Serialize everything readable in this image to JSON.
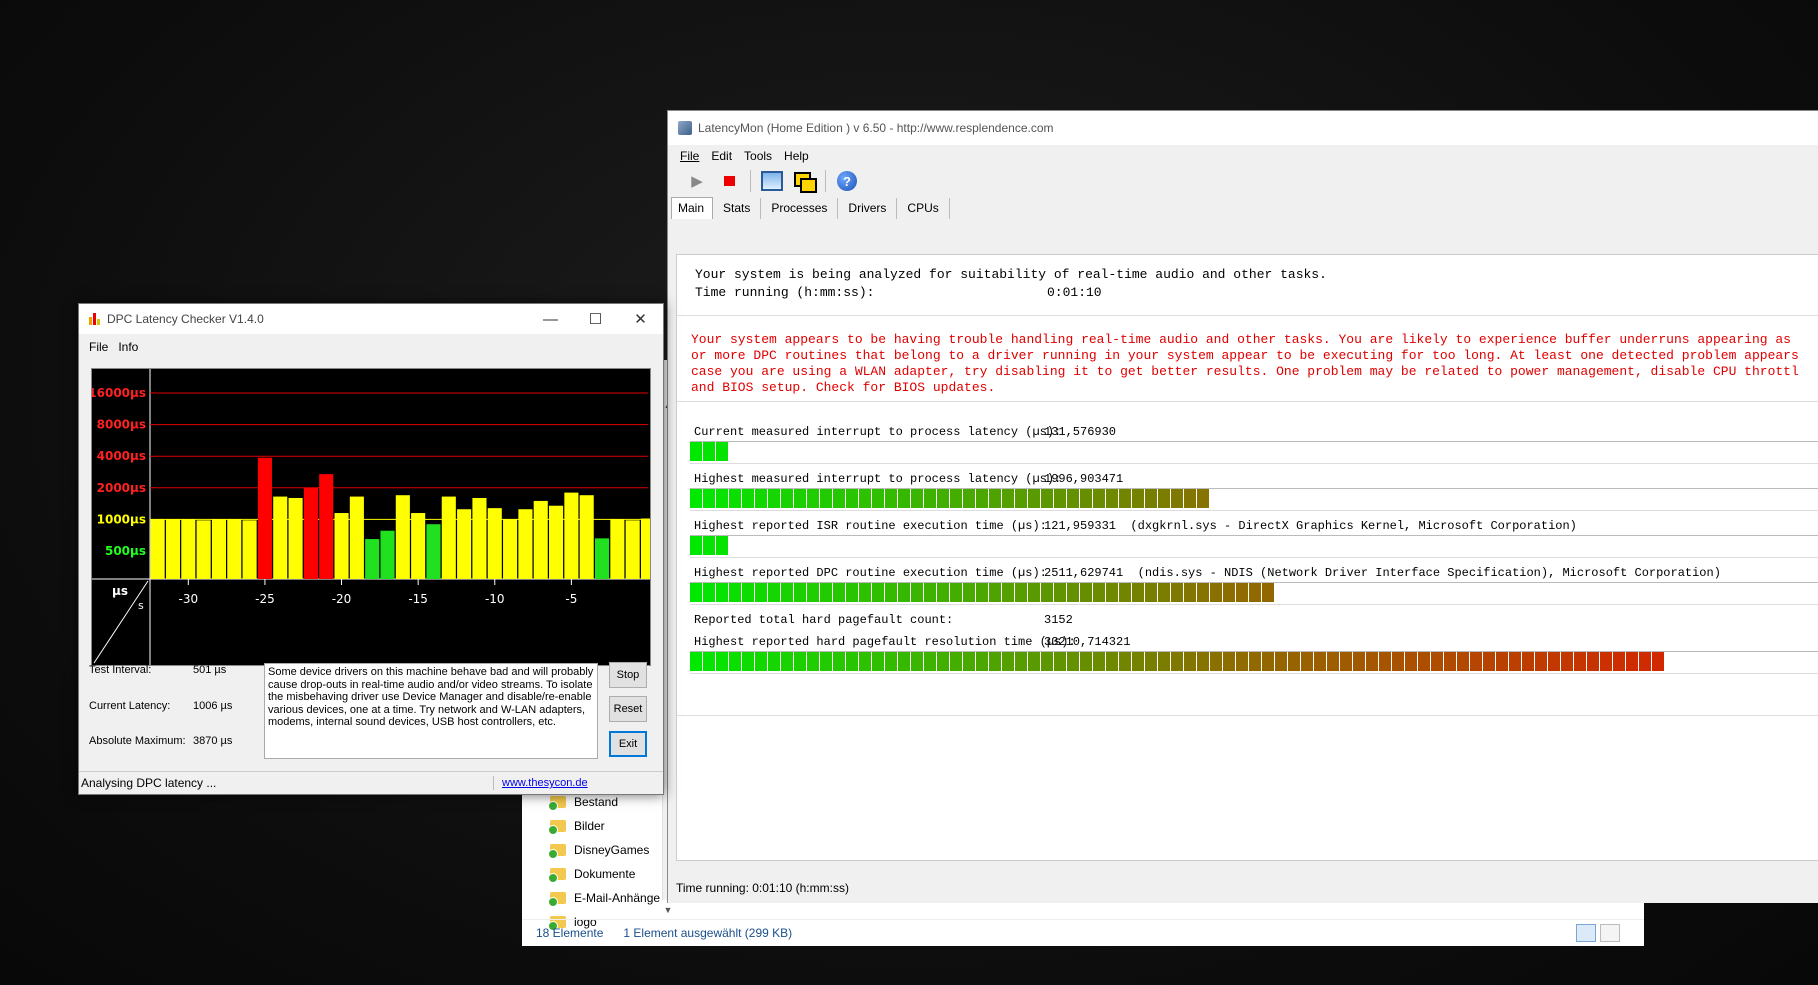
{
  "explorer": {
    "folders": [
      "Bestand",
      "Bilder",
      "DisneyGames",
      "Dokumente",
      "E-Mail-Anhänge",
      "logo"
    ],
    "item_count": "18 Elemente",
    "selection": "1 Element ausgewählt (299 KB)"
  },
  "latencymon": {
    "title": "LatencyMon  (Home Edition )  v 6.50 - http://www.resplendence.com",
    "menu": [
      "File",
      "Edit",
      "Tools",
      "Help"
    ],
    "tabs": [
      "Main",
      "Stats",
      "Processes",
      "Drivers",
      "CPUs"
    ],
    "analysis_line": "Your system is being analyzed for suitability of real-time audio and other tasks.",
    "time_label": "Time running (h:mm:ss):",
    "time_value": "0:01:10",
    "warning_lines": [
      "Your system appears to be having trouble handling real-time audio and other tasks. You are likely to experience buffer underruns appearing as",
      "or more DPC routines that belong to a driver running in your system appear to be executing for too long. At least one detected problem appears",
      "case you are using a WLAN adapter, try disabling it to get better results. One problem may be related to power management, disable CPU throttl",
      "and BIOS setup. Check for BIOS updates."
    ],
    "metrics": [
      {
        "label": "Current measured interrupt to process latency (µs):",
        "value": "131,576930",
        "bar_segments": 3
      },
      {
        "label": "Highest measured interrupt to process latency (µs):",
        "value": "1996,903471",
        "bar_segments": 40
      },
      {
        "label": "Highest reported ISR routine execution time (µs):",
        "value": "121,959331  (dxgkrnl.sys - DirectX Graphics Kernel, Microsoft Corporation)",
        "bar_segments": 3
      },
      {
        "label": "Highest reported DPC routine execution time (µs):",
        "value": "2511,629741  (ndis.sys - NDIS (Network Driver Interface Specification), Microsoft Corporation)",
        "bar_segments": 45
      }
    ],
    "pagefault_count_label": "Reported total hard pagefault count:",
    "pagefault_count_value": "3152",
    "pagefault_time_label": "Highest reported hard pagefault resolution time (µs):",
    "pagefault_time_value": "33210,714321",
    "pagefault_bar_segments": 75,
    "status": "Time running: 0:01:10  (h:mm:ss)"
  },
  "dpc": {
    "title": "DPC Latency Checker V1.4.0",
    "menu": [
      "File",
      "Info"
    ],
    "test_interval_label": "Test Interval:",
    "test_interval_value": "501 µs",
    "current_latency_label": "Current Latency:",
    "current_latency_value": "1006 µs",
    "absolute_max_label": "Absolute Maximum:",
    "absolute_max_value": "3870 µs",
    "message": "Some device drivers on this machine behave bad and will probably cause drop-outs in real-time audio and/or video streams. To isolate the misbehaving driver use Device Manager and disable/re-enable various devices, one at a time. Try network and W-LAN adapters, modems, internal sound devices, USB host controllers, etc.",
    "stop_label": "Stop",
    "reset_label": "Reset",
    "exit_label": "Exit",
    "status": "Analysing DPC latency ...",
    "link": "www.thesycon.de"
  },
  "chart_data": {
    "type": "bar",
    "y_scale": "log",
    "y_tick_labels": [
      {
        "label": "16000µs",
        "value": 16000,
        "color": "#ff2020"
      },
      {
        "label": "8000µs",
        "value": 8000,
        "color": "#ff2020"
      },
      {
        "label": "4000µs",
        "value": 4000,
        "color": "#ff2020"
      },
      {
        "label": "2000µs",
        "value": 2000,
        "color": "#ff2020"
      },
      {
        "label": "1000µs",
        "value": 1000,
        "color": "#ffff00"
      },
      {
        "label": "500µs",
        "value": 500,
        "color": "#20ff20"
      }
    ],
    "x_tick_labels": [
      "-30",
      "-25",
      "-20",
      "-15",
      "-10",
      "-5"
    ],
    "x_tick_values": [
      -30,
      -25,
      -20,
      -15,
      -10,
      -5
    ],
    "y_unit": "µs",
    "x_unit": "s",
    "xlim": [
      -32.5,
      0
    ],
    "colors": {
      "green": "#20e020",
      "yellow": "#ffff00",
      "red": "#ff0000"
    },
    "bars": [
      {
        "x": -32,
        "value": 1000,
        "color": "yellow"
      },
      {
        "x": -31,
        "value": 1000,
        "color": "yellow"
      },
      {
        "x": -30,
        "value": 1000,
        "color": "yellow"
      },
      {
        "x": -29,
        "value": 980,
        "color": "yellow"
      },
      {
        "x": -28,
        "value": 1000,
        "color": "yellow"
      },
      {
        "x": -27,
        "value": 1000,
        "color": "yellow"
      },
      {
        "x": -26,
        "value": 980,
        "color": "yellow"
      },
      {
        "x": -25,
        "value": 3870,
        "color": "red"
      },
      {
        "x": -24,
        "value": 1650,
        "color": "yellow"
      },
      {
        "x": -23,
        "value": 1600,
        "color": "yellow"
      },
      {
        "x": -22,
        "value": 2000,
        "color": "red"
      },
      {
        "x": -21,
        "value": 2700,
        "color": "red"
      },
      {
        "x": -20,
        "value": 1150,
        "color": "yellow"
      },
      {
        "x": -19,
        "value": 1650,
        "color": "yellow"
      },
      {
        "x": -18,
        "value": 650,
        "color": "green"
      },
      {
        "x": -17,
        "value": 780,
        "color": "green"
      },
      {
        "x": -16,
        "value": 1700,
        "color": "yellow"
      },
      {
        "x": -15,
        "value": 1150,
        "color": "yellow"
      },
      {
        "x": -14,
        "value": 900,
        "color": "green"
      },
      {
        "x": -13,
        "value": 1650,
        "color": "yellow"
      },
      {
        "x": -12,
        "value": 1250,
        "color": "yellow"
      },
      {
        "x": -11,
        "value": 1600,
        "color": "yellow"
      },
      {
        "x": -10,
        "value": 1280,
        "color": "yellow"
      },
      {
        "x": -9,
        "value": 1000,
        "color": "yellow"
      },
      {
        "x": -8,
        "value": 1250,
        "color": "yellow"
      },
      {
        "x": -7,
        "value": 1500,
        "color": "yellow"
      },
      {
        "x": -6,
        "value": 1350,
        "color": "yellow"
      },
      {
        "x": -5,
        "value": 1800,
        "color": "yellow"
      },
      {
        "x": -4,
        "value": 1700,
        "color": "yellow"
      },
      {
        "x": -3,
        "value": 660,
        "color": "green"
      },
      {
        "x": -2,
        "value": 1000,
        "color": "yellow"
      },
      {
        "x": -1,
        "value": 980,
        "color": "yellow"
      },
      {
        "x": 0,
        "value": 1020,
        "color": "yellow"
      }
    ]
  }
}
